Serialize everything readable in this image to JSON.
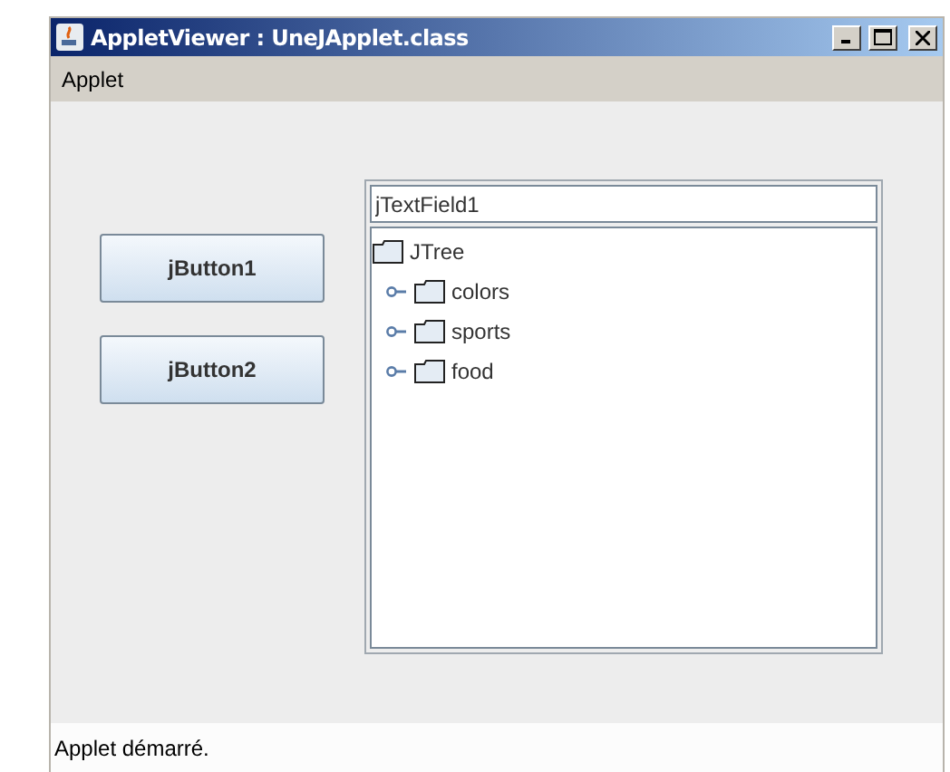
{
  "window": {
    "title": "AppletViewer : UneJApplet.class"
  },
  "menu": [
    "Applet"
  ],
  "buttons": [
    "jButton1",
    "jButton2"
  ],
  "text_field": {
    "value": "jTextField1"
  },
  "tree": {
    "label": "JTree",
    "expanded": true,
    "children": [
      {
        "label": "colors",
        "expanded": false
      },
      {
        "label": "sports",
        "expanded": false
      },
      {
        "label": "food",
        "expanded": false
      }
    ]
  },
  "status_bar": "Applet démarré."
}
